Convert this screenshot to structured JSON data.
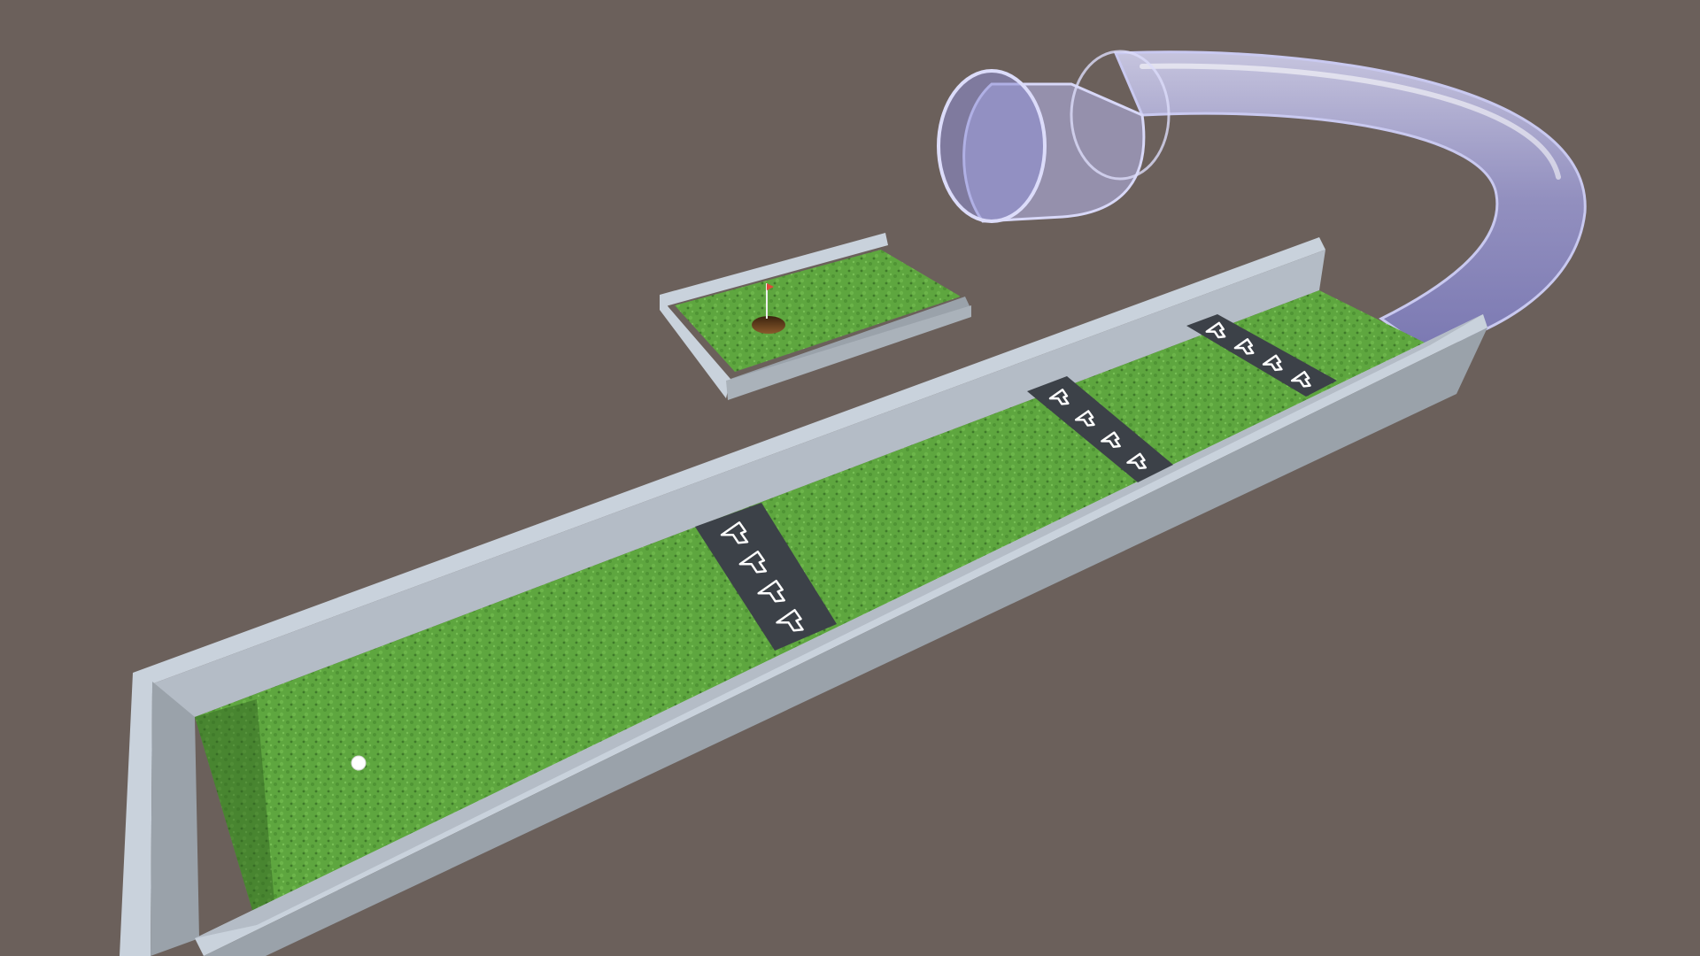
{
  "scene": {
    "background_color": "#6b605b",
    "grass_color": "#5ea63f",
    "grass_dark_color": "#3f7a2a",
    "wall_top_color": "#c9d2dc",
    "wall_side_color": "#9aa2aa",
    "wall_shadow_color": "#7f878f",
    "booster_color": "#3c4148",
    "arrow_color": "#ffffff",
    "tube_color": "#a8a8e6",
    "hole_color": "#5a3a1c",
    "ball_color": "#ffffff",
    "flag_color": "#e04a3a",
    "booster_count": 3,
    "arrows_per_booster": 4,
    "objects": [
      {
        "name": "main-fairway",
        "type": "fairway"
      },
      {
        "name": "goal-green",
        "type": "green-with-hole"
      },
      {
        "name": "transfer-tube",
        "type": "curved-tube"
      },
      {
        "name": "golf-ball",
        "type": "ball"
      },
      {
        "name": "hole-flag",
        "type": "flag"
      }
    ]
  }
}
